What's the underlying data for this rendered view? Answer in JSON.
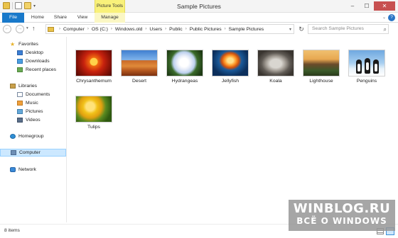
{
  "window": {
    "title": "Sample Pictures",
    "contextual_tab": "Picture Tools"
  },
  "ribbon": {
    "tabs": [
      "File",
      "Home",
      "Share",
      "View",
      "Manage"
    ]
  },
  "address_bar": {
    "breadcrumbs": [
      "Computer",
      "OS (C:)",
      "Windows.old",
      "Users",
      "Public",
      "Public Pictures",
      "Sample Pictures"
    ]
  },
  "search": {
    "placeholder": "Search Sample Pictures"
  },
  "sidebar": {
    "favorites_label": "Favorites",
    "favorites": [
      "Desktop",
      "Downloads",
      "Recent places"
    ],
    "libraries_label": "Libraries",
    "libraries": [
      "Documents",
      "Music",
      "Pictures",
      "Videos"
    ],
    "homegroup": "Homegroup",
    "computer": "Computer",
    "network": "Network"
  },
  "files": [
    {
      "name": "Chrysanthemum"
    },
    {
      "name": "Desert"
    },
    {
      "name": "Hydrangeas"
    },
    {
      "name": "Jellyfish"
    },
    {
      "name": "Koala"
    },
    {
      "name": "Lighthouse"
    },
    {
      "name": "Penguins"
    },
    {
      "name": "Tulips"
    }
  ],
  "status": {
    "item_count": "8 items"
  },
  "watermark": {
    "line1": "WINBLOG.RU",
    "line2": "ВСЁ О WINDOWS"
  },
  "colors": {
    "file_tab": "#1979ca",
    "contextual_tab": "#f9f17a",
    "selection": "#cce8ff",
    "close_button": "#c75050"
  }
}
